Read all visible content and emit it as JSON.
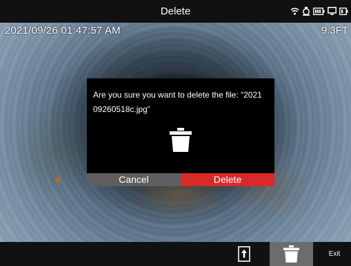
{
  "header": {
    "title": "Delete",
    "status_icons": [
      "wifi-icon",
      "light-icon",
      "battery-icon",
      "screen-icon",
      "battery-small-icon"
    ]
  },
  "overlay": {
    "datetime": "2021/09/26 01:47:57 AM",
    "distance": "9.3FT"
  },
  "dialog": {
    "message": "Are you sure you want to delete the file: “2021 09260518c.jpg”",
    "icon": "trash-icon",
    "cancel_label": "Cancel",
    "delete_label": "Delete"
  },
  "bottom_bar": {
    "export_icon": "export-icon",
    "delete_icon": "trash-icon",
    "exit_label": "Exit"
  },
  "colors": {
    "delete_button": "#d92a2a",
    "cancel_button": "#5e5e5e",
    "bar_background": "#111111",
    "selected_tool": "#6c6c6c"
  }
}
